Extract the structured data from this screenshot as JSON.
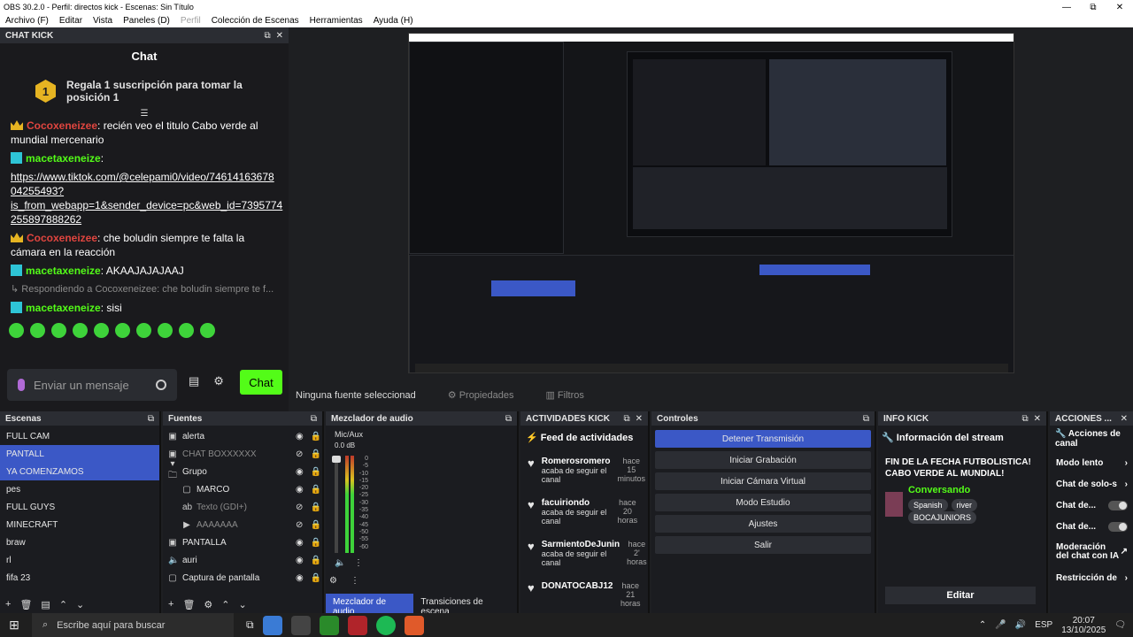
{
  "window": {
    "title": "OBS 30.2.0 - Perfil: directos kick - Escenas: Sin Título",
    "minimize": "—",
    "restore": "⧉",
    "close": "✕"
  },
  "menu": [
    {
      "label": "Archivo (F)",
      "disabled": false
    },
    {
      "label": "Editar",
      "disabled": false
    },
    {
      "label": "Vista",
      "disabled": false
    },
    {
      "label": "Paneles (D)",
      "disabled": false
    },
    {
      "label": "Perfil",
      "disabled": true
    },
    {
      "label": "Colección de Escenas",
      "disabled": false
    },
    {
      "label": "Herramientas",
      "disabled": false
    },
    {
      "label": "Ayuda (H)",
      "disabled": false
    }
  ],
  "chat": {
    "dock_title": "CHAT KICK",
    "title": "Chat",
    "goal_rank": "1",
    "goal_text": "Regala 1 suscripción para tomar la posición 1",
    "messages": [
      {
        "user": "Cocoxeneizee",
        "text": ": recién veo el titulo Cabo verde al mundial mercenario",
        "style": "red"
      },
      {
        "user": "macetaxeneize",
        "text": ":",
        "style": "green"
      },
      {
        "link": "https://www.tiktok.com/@celepami0/video/74614163678 04255493? is_from_webapp=1&sender_device=pc&web_id=7395774 255897888262"
      },
      {
        "user": "Cocoxeneizee",
        "text": ": che boludin siempre te falta la cámara en la reacción",
        "style": "red"
      },
      {
        "user": "macetaxeneize",
        "text": ": AKAAJAJAJAAJ",
        "style": "green"
      },
      {
        "reply": "↳ Respondiendo a Cocoxeneizee: che boludin siempre te f..."
      },
      {
        "user": "macetaxeneize",
        "text": ": sisi",
        "style": "green"
      }
    ],
    "input_placeholder": "Enviar un mensaje",
    "send_label": "Chat"
  },
  "preview": {
    "no_source": "Ninguna fuente seleccionad",
    "properties": "Propiedades",
    "filters": "Filtros"
  },
  "scenes": {
    "title": "Escenas",
    "items": [
      "FULL CAM",
      "PANTALL",
      "YA COMENZAMOS",
      "pes",
      "FULL GUYS",
      "MINECRAFT",
      "braw",
      "rl",
      "fifa 23"
    ],
    "selected": [
      1,
      2
    ]
  },
  "sources": {
    "title": "Fuentes",
    "items": [
      {
        "label": "alerta",
        "icon": "▣",
        "dim": false
      },
      {
        "label": "CHAT BOXXXXXX",
        "icon": "▣",
        "dim": true
      },
      {
        "label": "Grupo",
        "icon": "▾ 🗀",
        "dim": false
      },
      {
        "label": "MARCO",
        "icon": "▢",
        "dim": false
      },
      {
        "label": "Texto (GDI+)",
        "icon": "ab",
        "dim": true
      },
      {
        "label": "AAAAAAA",
        "icon": "▶",
        "dim": true
      },
      {
        "label": "PANTALLA",
        "icon": "▣",
        "dim": false
      },
      {
        "label": "auri",
        "icon": "🔈",
        "dim": false
      },
      {
        "label": "Captura de pantalla",
        "icon": "▢",
        "dim": false
      }
    ]
  },
  "mixer": {
    "title": "Mezclador de audio",
    "channel": "Mic/Aux",
    "db": "0.0 dB",
    "ticks": [
      "0",
      "-5",
      "-10",
      "-15",
      "-20",
      "-25",
      "-30",
      "-35",
      "-40",
      "-45",
      "-50",
      "-55",
      "-60"
    ],
    "tab_mixer": "Mezclador de audio",
    "tab_transitions": "Transiciones de escena"
  },
  "activity": {
    "title": "ACTIVIDADES KICK",
    "feed_title": "Feed de actividades",
    "items": [
      {
        "name": "Romerosromero",
        "time": "hace 15 minutos",
        "desc": "acaba de seguir el canal"
      },
      {
        "name": "facuiriondo",
        "time": "hace 20 horas",
        "desc": "acaba de seguir el canal"
      },
      {
        "name": "SarmientoDeJunin",
        "time": "hace 2' horas",
        "desc": "acaba de seguir el canal"
      },
      {
        "name": "DONATOCABJ12",
        "time": "hace 21 horas",
        "desc": ""
      }
    ]
  },
  "controls": {
    "title": "Controles",
    "buttons": [
      "Detener Transmisión",
      "Iniciar Grabación",
      "Iniciar Cámara Virtual",
      "Modo Estudio",
      "Ajustes",
      "Salir"
    ]
  },
  "info": {
    "title": "INFO KICK",
    "heading": "Información del stream",
    "stream_title": "FIN DE LA FECHA FUTBOLISTICA! CABO VERDE AL MUNDIAL!",
    "category": "Conversando",
    "tags": [
      "Spanish",
      "river",
      "BOCAJUNIORS"
    ],
    "edit": "Editar"
  },
  "actions": {
    "title": "ACCIONES ...",
    "heading": "Acciones de canal",
    "items": [
      {
        "label": "Modo lento",
        "type": "arrow"
      },
      {
        "label": "Chat de solo-s",
        "type": "arrow"
      },
      {
        "label": "Chat de...",
        "type": "toggle"
      },
      {
        "label": "Chat de...",
        "type": "toggle"
      },
      {
        "label": "Moderación del chat con IA",
        "type": "link"
      },
      {
        "label": "Restricción de",
        "type": "arrow"
      }
    ]
  },
  "taskbar": {
    "search_placeholder": "Escribe aquí para buscar",
    "lang": "ESP",
    "time": "20:07",
    "date": "13/10/2025"
  }
}
